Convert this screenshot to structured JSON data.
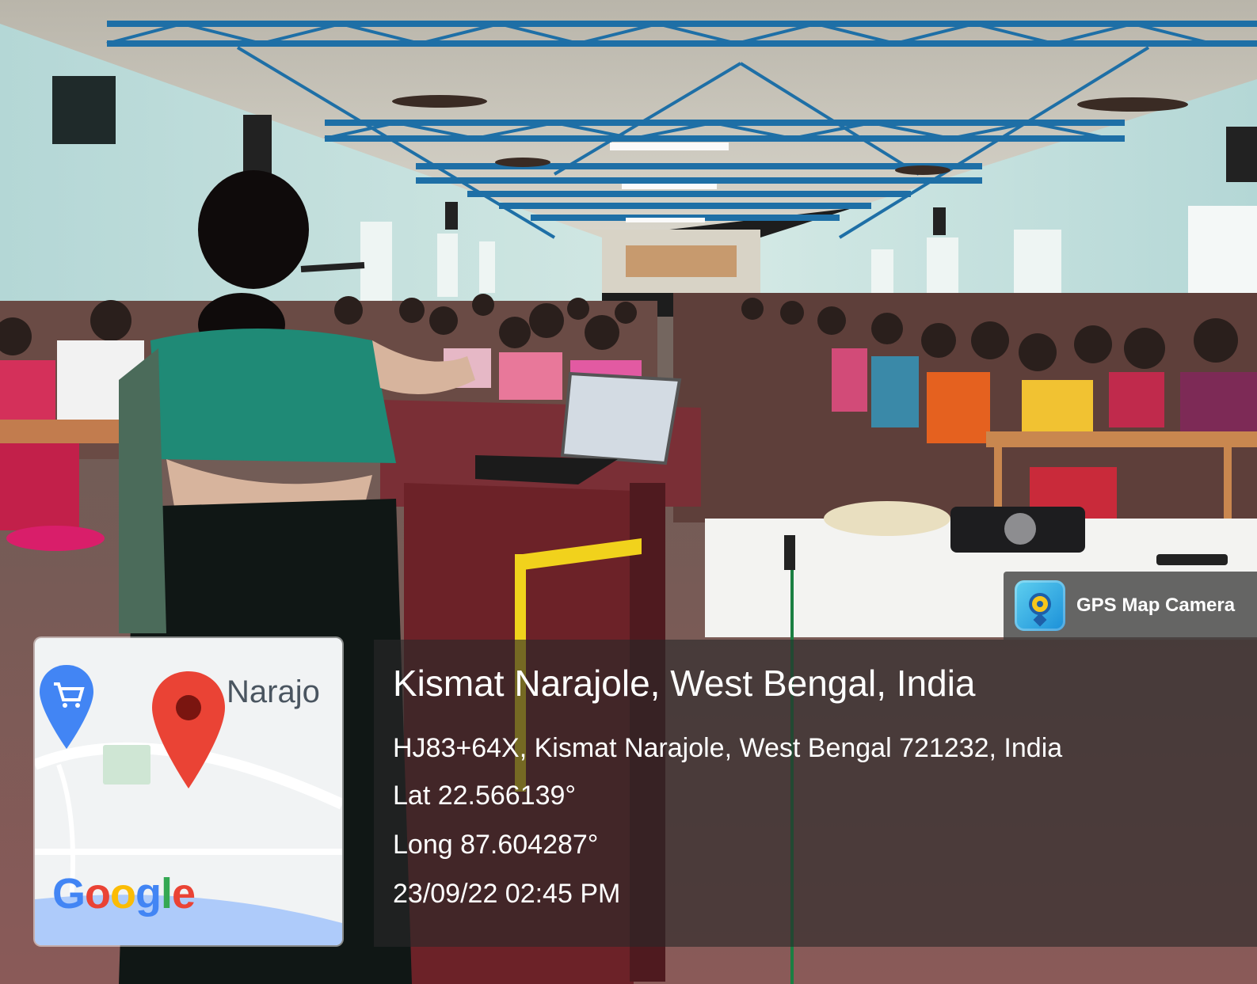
{
  "photo": {
    "description_hidden": ""
  },
  "gps_badge": {
    "label": "GPS Map Camera",
    "icon": "camera-lens-icon"
  },
  "location": {
    "title": "Kismat Narajole, West Bengal, India",
    "address": "HJ83+64X, Kismat Narajole, West Bengal 721232, India",
    "lat": "Lat 22.566139°",
    "long": "Long 87.604287°",
    "timestamp": "23/09/22 02:45 PM"
  },
  "map": {
    "place_label": "Narajo",
    "brand": [
      "G",
      "o",
      "o",
      "g",
      "l",
      "e"
    ],
    "brand_colors": [
      "#4285F4",
      "#EA4335",
      "#FBBC05",
      "#4285F4",
      "#34A853",
      "#EA4335"
    ],
    "pin_color": "#EA4335",
    "shop_pin_color": "#4285F4",
    "shop_icon": "shopping-cart-icon",
    "pin_icon": "map-pin-icon"
  }
}
